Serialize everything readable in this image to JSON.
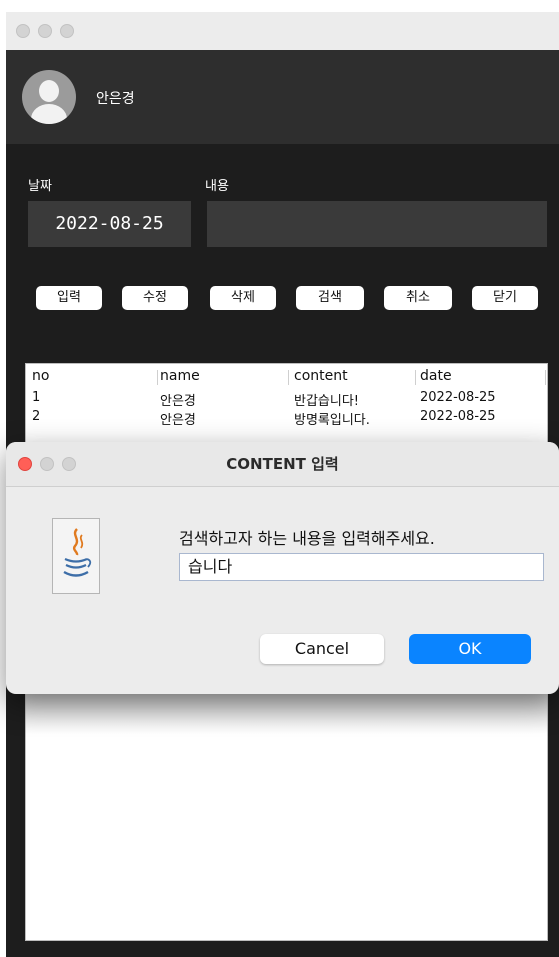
{
  "header": {
    "username": "안은경"
  },
  "form": {
    "date_label": "날짜",
    "content_label": "내용",
    "date_value": "2022-08-25",
    "content_value": ""
  },
  "buttons": {
    "insert": "입력",
    "update": "수정",
    "delete": "삭제",
    "search": "검색",
    "cancel": "취소",
    "close": "닫기"
  },
  "table": {
    "columns": [
      "no",
      "name",
      "content",
      "date"
    ],
    "rows": [
      {
        "no": "1",
        "name": "안은경",
        "content": "반갑습니다!",
        "date": "2022-08-25"
      },
      {
        "no": "2",
        "name": "안은경",
        "content": "방명록입니다.",
        "date": "2022-08-25"
      }
    ]
  },
  "dialog": {
    "title": "CONTENT 입력",
    "prompt": "검색하고자 하는 내용을 입력해주세요.",
    "input_value": "습니다",
    "cancel_label": "Cancel",
    "ok_label": "OK",
    "icon": "java-icon"
  },
  "colors": {
    "window_bg": "#1d1d1d",
    "header_bg": "#2e2e2e",
    "ok_blue": "#0a84ff",
    "close_red": "#ff5f57"
  }
}
